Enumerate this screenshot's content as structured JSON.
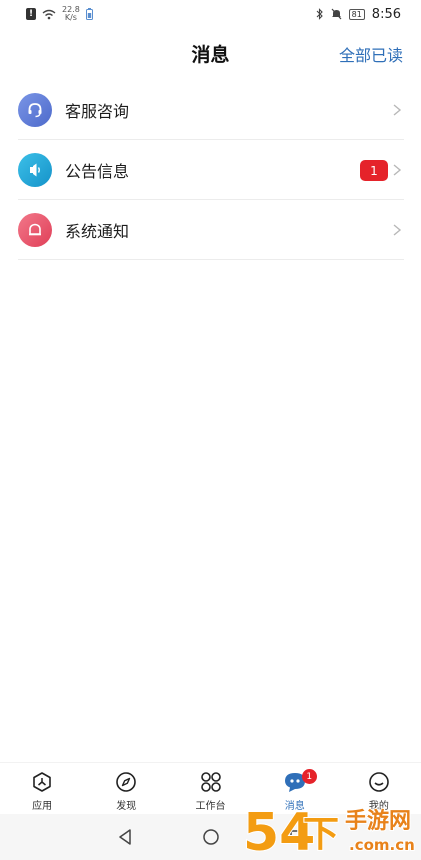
{
  "status_bar": {
    "speed_value": "22.8",
    "speed_unit": "K/s",
    "battery": "81",
    "time": "8:56"
  },
  "header": {
    "title": "消息",
    "action": "全部已读"
  },
  "messages": [
    {
      "label": "客服咨询",
      "icon": "headset-icon",
      "color": "#5b7bd9",
      "badge": ""
    },
    {
      "label": "公告信息",
      "icon": "speaker-icon",
      "color": "#1fa5d6",
      "badge": "1"
    },
    {
      "label": "系统通知",
      "icon": "bell-icon",
      "color": "#e94f66",
      "badge": ""
    }
  ],
  "tabs": [
    {
      "label": "应用",
      "icon": "app-icon"
    },
    {
      "label": "发现",
      "icon": "compass-icon"
    },
    {
      "label": "工作台",
      "icon": "workbench-icon"
    },
    {
      "label": "消息",
      "icon": "chat-icon",
      "badge": "1",
      "active": true
    },
    {
      "label": "我的",
      "icon": "profile-icon"
    }
  ],
  "watermark": {
    "big": "54",
    "mid": "下",
    "right_top": "手游网",
    "right_bottom": ".com.cn"
  },
  "colors": {
    "accent": "#2f6fb8",
    "badge": "#e5232a"
  }
}
